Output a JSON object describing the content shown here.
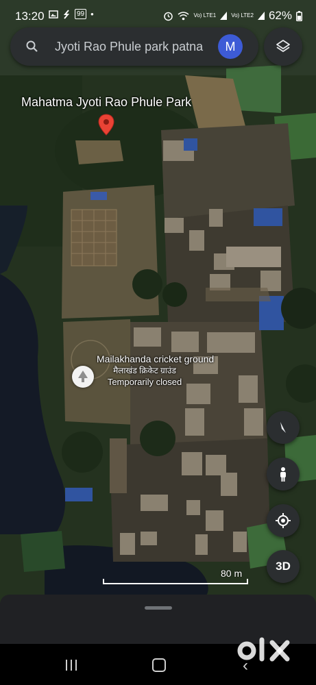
{
  "status_bar": {
    "time": "13:20",
    "notification_badge": "99",
    "network_1": "Vo) LTE1",
    "network_2": "Vo) LTE2",
    "battery": "62%",
    "icons": [
      "image-icon",
      "missed-call-icon",
      "badge-icon",
      "dot-icon",
      "alarm-icon",
      "wifi-icon",
      "signal-icon",
      "battery-icon"
    ]
  },
  "search": {
    "value": "Jyoti Rao Phule park patna",
    "avatar_initial": "M"
  },
  "map": {
    "type": "satellite",
    "places": [
      {
        "name": "Mahatma Jyoti Rao Phule Park",
        "marker": "red-pin"
      },
      {
        "name": "Mailakhanda cricket ground",
        "name_local": "मैलाखंड क्रिकेट ग्राउंड",
        "status": "Temporarily closed",
        "marker": "tree-marker"
      }
    ],
    "scale_label": "80 m"
  },
  "controls": {
    "threed_label": "3D",
    "icons": [
      "layers-icon",
      "compass-icon",
      "pegman-icon",
      "my-location-icon"
    ]
  },
  "watermark": "olx",
  "colors": {
    "accent_avatar": "#3d5bd6",
    "pin_red": "#ea4335",
    "control_bg": "#2b2e30"
  }
}
